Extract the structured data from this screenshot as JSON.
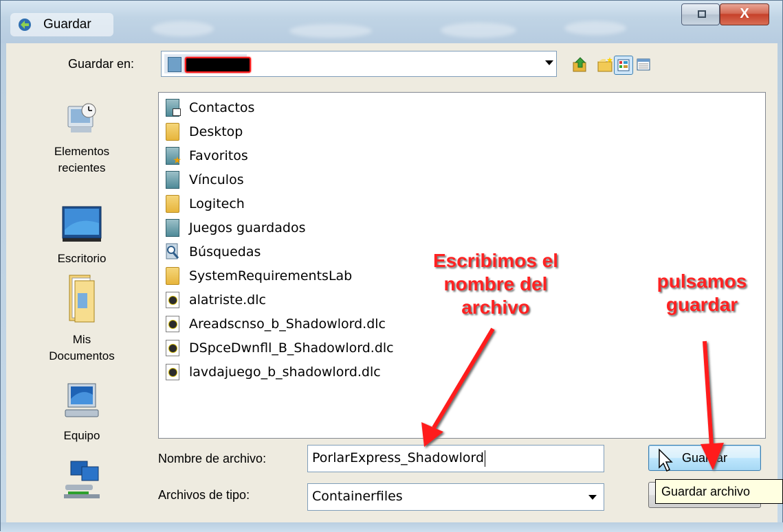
{
  "window": {
    "title": "Guardar",
    "close_glyph": "X"
  },
  "toolbar": {
    "save_in_label": "Guardar en:",
    "icons": [
      "up-folder-icon",
      "new-folder-icon",
      "view-menu-icon",
      "details-view-icon"
    ]
  },
  "places": [
    {
      "label_lines": [
        "Elementos",
        "recientes"
      ],
      "icon": "recent-items-icon"
    },
    {
      "label_lines": [
        "Escritorio"
      ],
      "icon": "desktop-icon"
    },
    {
      "label_lines": [
        "Mis",
        "Documentos"
      ],
      "icon": "documents-icon"
    },
    {
      "label_lines": [
        "Equipo"
      ],
      "icon": "computer-icon"
    },
    {
      "label_lines": [],
      "icon": "network-icon"
    }
  ],
  "files": [
    {
      "name": "Contactos",
      "type": "sysfolder-card"
    },
    {
      "name": "Desktop",
      "type": "folder"
    },
    {
      "name": "Favoritos",
      "type": "sysfolder-star"
    },
    {
      "name": "Vínculos",
      "type": "sysfolder"
    },
    {
      "name": "Logitech",
      "type": "folder"
    },
    {
      "name": "Juegos guardados",
      "type": "sysfolder"
    },
    {
      "name": "Búsquedas",
      "type": "search-folder"
    },
    {
      "name": "SystemRequirementsLab",
      "type": "folder"
    },
    {
      "name": "alatriste.dlc",
      "type": "dlc"
    },
    {
      "name": "Areadscnso_b_Shadowlord.dlc",
      "type": "dlc"
    },
    {
      "name": "DSpceDwnfll_B_Shadowlord.dlc",
      "type": "dlc"
    },
    {
      "name": "lavdajuego_b_shadowlord.dlc",
      "type": "dlc"
    }
  ],
  "form": {
    "filename_label": "Nombre de archivo:",
    "filename_value": "PorlarExpress_Shadowlord",
    "filetype_label": "Archivos de tipo:",
    "filetype_value": "Containerfiles",
    "save_button": "Guardar",
    "tooltip": "Guardar archivo"
  },
  "annotations": {
    "left": [
      "Escribimos el",
      "nombre del",
      "archivo"
    ],
    "right": [
      "pulsamos",
      "guardar"
    ],
    "color": "#ff2222"
  }
}
